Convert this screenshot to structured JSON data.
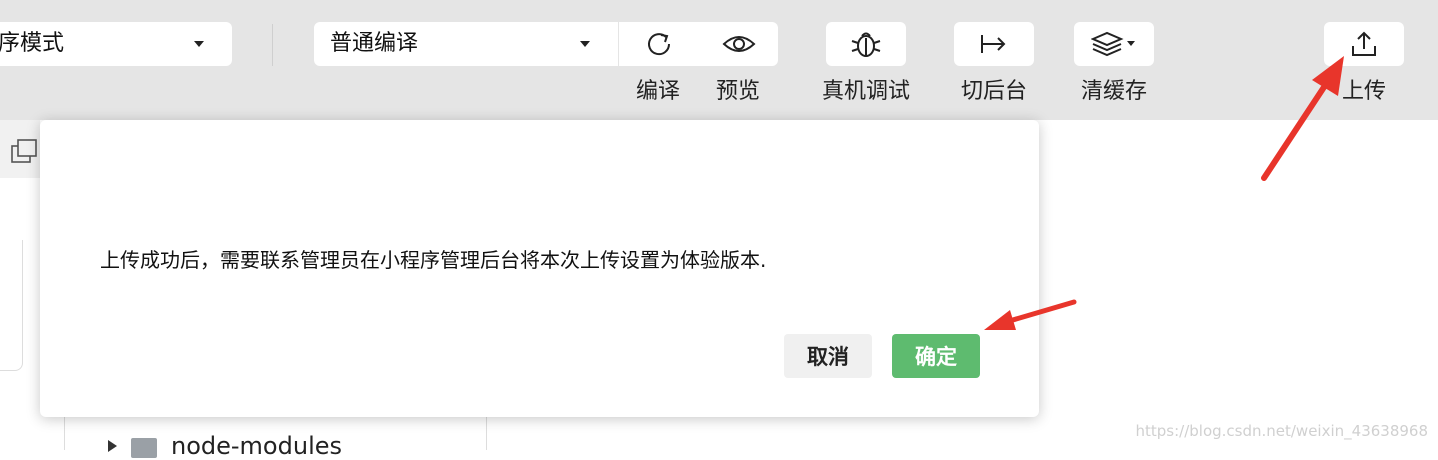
{
  "toolbar": {
    "mode_select": "序模式",
    "compile_select": "普通编译",
    "buttons": [
      {
        "icon": "refresh-icon",
        "label": "编译"
      },
      {
        "icon": "eye-icon",
        "label": "预览"
      },
      {
        "icon": "bug-icon",
        "label": "真机调试"
      },
      {
        "icon": "switch-background-icon",
        "label": "切后台"
      },
      {
        "icon": "layers-icon",
        "label": "清缓存"
      },
      {
        "icon": "upload-icon",
        "label": "上传"
      }
    ]
  },
  "file_tree": {
    "visible_item": "node-modules"
  },
  "dialog": {
    "message": "上传成功后，需要联系管理员在小程序管理后台将本次上传设置为体验版本.",
    "cancel_label": "取消",
    "confirm_label": "确定"
  },
  "watermark": "https://blog.csdn.net/weixin_43638968",
  "colors": {
    "toolbar_bg": "#e5e5e5",
    "confirm_green": "#5ebb6f",
    "annotation_red": "#e8352b"
  }
}
